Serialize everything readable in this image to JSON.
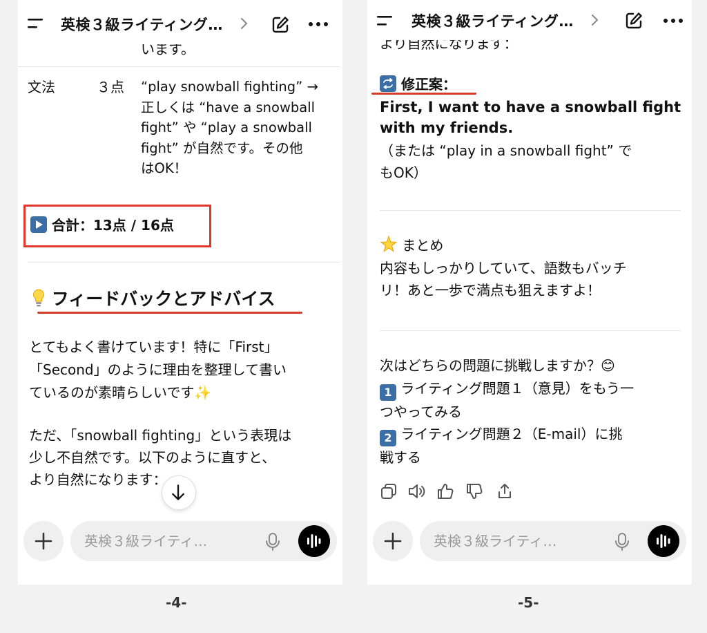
{
  "left": {
    "header": {
      "title": "英検３級ライティング…"
    },
    "top_partial": "います。",
    "grammar": {
      "label": "文法",
      "score": "３点",
      "lines": [
        "“play snowball fighting” →",
        "正しくは “have a snowball",
        "fight” や “play a snowball",
        "fight” が自然です。その他",
        "はOK！"
      ]
    },
    "total": "合計：13点 / 16点",
    "feedback_heading": "フィードバックとアドバイス",
    "paragraph1": [
      "とてもよく書けています！特に「First」",
      "「Second」のように理由を整理して書い",
      "ているのが素晴らしいです✨"
    ],
    "paragraph2": [
      "ただ、「snowball fighting」という表現は",
      "少し不自然です。以下のように直すと、",
      "より自然になります："
    ],
    "input_placeholder": "英検３級ライティ…",
    "page_number": "-4-"
  },
  "right": {
    "header": {
      "title": "英検３級ライティング…"
    },
    "top_partial": "より自然になります：",
    "correction_heading": "修正案：",
    "correction_lines": [
      "First, I want to have a snowball fight",
      "with my friends."
    ],
    "correction_note": [
      "（または “play in a snowball fight” で",
      "もOK）"
    ],
    "summary_heading": "まとめ",
    "summary_lines": [
      "内容もしっかりしていて、語数もバッチ",
      "リ！あと一歩で満点も狙えますよ！"
    ],
    "next_question": "次はどちらの問題に挑戦しますか？😊",
    "options": [
      {
        "badge": "1",
        "lines": [
          "ライティング問題１（意見）をもう一",
          "つやってみる"
        ]
      },
      {
        "badge": "2",
        "lines": [
          "ライティング問題２（E-mail）に挑",
          "戦する"
        ]
      }
    ],
    "input_placeholder": "英検３級ライティ…",
    "page_number": "-5-"
  },
  "icons": {
    "menu": "menu-icon",
    "chevron": "chevron-right-icon",
    "edit": "edit-icon",
    "more": "more-icon",
    "plus": "plus-icon",
    "mic": "mic-icon",
    "voice": "voice-mode-icon",
    "scroll": "arrow-down-icon",
    "play": "play-button-icon",
    "bulb": "lightbulb-icon",
    "repeat": "repeat-icon",
    "sparkle": "glowing-star-icon",
    "copy": "copy-icon",
    "speaker": "read-aloud-icon",
    "thumbs_up": "thumbs-up-icon",
    "thumbs_down": "thumbs-down-icon",
    "share": "share-icon"
  },
  "colors": {
    "highlight_red": "#e0352b",
    "emoji_blue": "#3b6ea5",
    "voice_button": "#000000"
  }
}
